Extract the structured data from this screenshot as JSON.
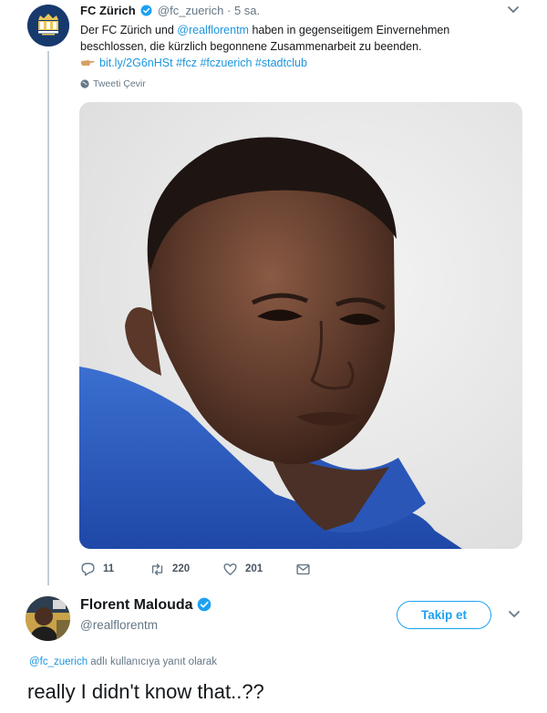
{
  "tweet1": {
    "display_name": "FC Zürich",
    "handle": "@fc_zuerich",
    "separator": "·",
    "time": "5 sa.",
    "text": "Der FC Zürich und @realflorentm haben in gegenseitigem Einvernehmen beschlossen, die kürzlich begonnene Zusammenarbeit zu beenden.",
    "text_pre": "Der FC Zürich und ",
    "text_mention": "@realflorentm",
    "text_post": " haben in gegenseitigem Einvernehmen beschlossen, die kürzlich begonnene Zusammenarbeit zu beenden.",
    "link": "bit.ly/2G6nHSt",
    "hashtags": "#fcz #fczuerich #stadtclub",
    "translate_label": "Tweeti Çevir",
    "actions": {
      "replies": "11",
      "retweets": "220",
      "likes": "201"
    }
  },
  "tweet2": {
    "display_name": "Florent Malouda",
    "handle": "@realflorentm",
    "follow_label": "Takip et",
    "reply_to_handle": "@fc_zuerich",
    "reply_to_suffix": " adlı kullanıcıya yanıt olarak",
    "text": "really I didn't know that..??"
  },
  "colors": {
    "link": "#1b95e0",
    "accent": "#1da1f2",
    "muted": "#657786",
    "thread_line": "#c4cfd6"
  },
  "icons": [
    "verified-badge-icon",
    "chevron-down-icon",
    "pointing-hand-icon",
    "globe-icon",
    "reply-icon",
    "retweet-icon",
    "like-icon",
    "share-icon"
  ]
}
